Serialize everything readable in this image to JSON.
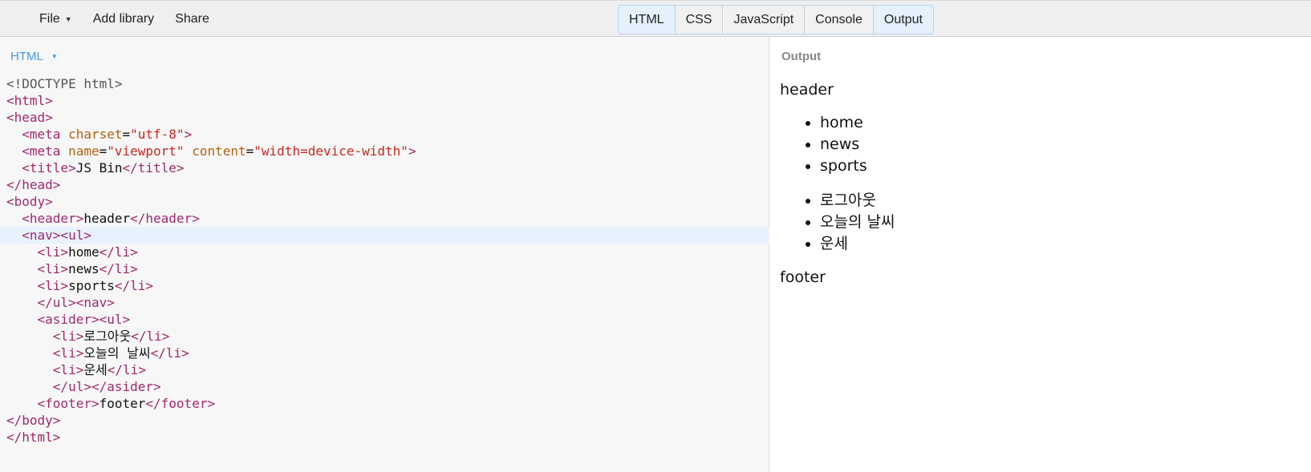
{
  "menu": {
    "file_label": "File",
    "add_library_label": "Add library",
    "share_label": "Share"
  },
  "panel_tabs": [
    {
      "label": "HTML",
      "active": true
    },
    {
      "label": "CSS",
      "active": false
    },
    {
      "label": "JavaScript",
      "active": false
    },
    {
      "label": "Console",
      "active": false
    },
    {
      "label": "Output",
      "active": true
    }
  ],
  "editor": {
    "label": "HTML",
    "active_line": 10,
    "lines": [
      [
        {
          "t": "meta",
          "v": "<!DOCTYPE html>"
        }
      ],
      [
        {
          "t": "tag",
          "v": "<html>"
        }
      ],
      [
        {
          "t": "tag",
          "v": "<head>"
        }
      ],
      [
        {
          "t": "text",
          "v": "  "
        },
        {
          "t": "tag",
          "v": "<meta "
        },
        {
          "t": "attr",
          "v": "charset"
        },
        {
          "t": "text",
          "v": "="
        },
        {
          "t": "str",
          "v": "\"utf-8\""
        },
        {
          "t": "tag",
          "v": ">"
        }
      ],
      [
        {
          "t": "text",
          "v": "  "
        },
        {
          "t": "tag",
          "v": "<meta "
        },
        {
          "t": "attr",
          "v": "name"
        },
        {
          "t": "text",
          "v": "="
        },
        {
          "t": "str",
          "v": "\"viewport\""
        },
        {
          "t": "text",
          "v": " "
        },
        {
          "t": "attr",
          "v": "content"
        },
        {
          "t": "text",
          "v": "="
        },
        {
          "t": "str",
          "v": "\"width=device-width\""
        },
        {
          "t": "tag",
          "v": ">"
        }
      ],
      [
        {
          "t": "text",
          "v": "  "
        },
        {
          "t": "tag",
          "v": "<title>"
        },
        {
          "t": "text",
          "v": "JS Bin"
        },
        {
          "t": "tag",
          "v": "</title>"
        }
      ],
      [
        {
          "t": "tag",
          "v": "</head>"
        }
      ],
      [
        {
          "t": "tag",
          "v": "<body>"
        }
      ],
      [
        {
          "t": "text",
          "v": "  "
        },
        {
          "t": "tag",
          "v": "<header>"
        },
        {
          "t": "text",
          "v": "header"
        },
        {
          "t": "tag",
          "v": "</header>"
        }
      ],
      [
        {
          "t": "text",
          "v": "  "
        },
        {
          "t": "tag",
          "v": "<nav><ul>"
        }
      ],
      [
        {
          "t": "text",
          "v": "    "
        },
        {
          "t": "tag",
          "v": "<li>"
        },
        {
          "t": "text",
          "v": "home"
        },
        {
          "t": "tag",
          "v": "</li>"
        }
      ],
      [
        {
          "t": "text",
          "v": "    "
        },
        {
          "t": "tag",
          "v": "<li>"
        },
        {
          "t": "text",
          "v": "news"
        },
        {
          "t": "tag",
          "v": "</li>"
        }
      ],
      [
        {
          "t": "text",
          "v": "    "
        },
        {
          "t": "tag",
          "v": "<li>"
        },
        {
          "t": "text",
          "v": "sports"
        },
        {
          "t": "tag",
          "v": "</li>"
        }
      ],
      [
        {
          "t": "text",
          "v": "    "
        },
        {
          "t": "tag",
          "v": "</ul><nav>"
        }
      ],
      [
        {
          "t": "text",
          "v": "    "
        },
        {
          "t": "tag",
          "v": "<asider><ul>"
        }
      ],
      [
        {
          "t": "text",
          "v": "      "
        },
        {
          "t": "tag",
          "v": "<li>"
        },
        {
          "t": "text",
          "v": "로그아웃"
        },
        {
          "t": "tag",
          "v": "</li>"
        }
      ],
      [
        {
          "t": "text",
          "v": "      "
        },
        {
          "t": "tag",
          "v": "<li>"
        },
        {
          "t": "text",
          "v": "오늘의 날씨"
        },
        {
          "t": "tag",
          "v": "</li>"
        }
      ],
      [
        {
          "t": "text",
          "v": "      "
        },
        {
          "t": "tag",
          "v": "<li>"
        },
        {
          "t": "text",
          "v": "운세"
        },
        {
          "t": "tag",
          "v": "</li>"
        }
      ],
      [
        {
          "t": "text",
          "v": "      "
        },
        {
          "t": "tag",
          "v": "</ul></asider>"
        }
      ],
      [
        {
          "t": "text",
          "v": "    "
        },
        {
          "t": "tag",
          "v": "<footer>"
        },
        {
          "t": "text",
          "v": "footer"
        },
        {
          "t": "tag",
          "v": "</footer>"
        }
      ],
      [
        {
          "t": "tag",
          "v": "</body>"
        }
      ],
      [
        {
          "t": "tag",
          "v": "</html>"
        }
      ]
    ]
  },
  "output": {
    "label": "Output",
    "header_text": "header",
    "nav_items": [
      "home",
      "news",
      "sports"
    ],
    "aside_items": [
      "로그아웃",
      "오늘의 날씨",
      "운세"
    ],
    "footer_text": "footer"
  }
}
